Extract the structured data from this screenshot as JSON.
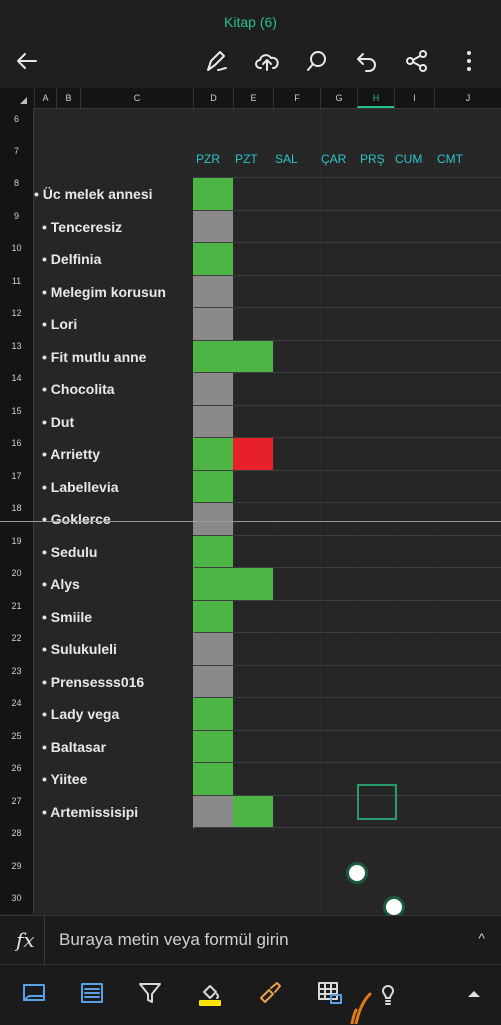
{
  "app": {
    "title": "Kitap (6)"
  },
  "toolbar": {
    "icons": [
      "back-arrow-icon",
      "draw-pen-icon",
      "cloud-upload-icon",
      "search-icon",
      "undo-icon",
      "share-icon",
      "more-icon"
    ]
  },
  "sheet": {
    "columns": [
      "A",
      "B",
      "C",
      "D",
      "E",
      "F",
      "G",
      "H",
      "I",
      "J"
    ],
    "selected_column": "H",
    "rows": [
      "6",
      "7",
      "8",
      "9",
      "10",
      "11",
      "12",
      "13",
      "14",
      "15",
      "16",
      "17",
      "18",
      "19",
      "20",
      "21",
      "22",
      "23",
      "24",
      "25",
      "26",
      "27",
      "28",
      "29",
      "30"
    ],
    "days": [
      "PZR",
      "PZT",
      "SAL",
      "ÇAR",
      "PRŞ",
      "CUM",
      "CMT"
    ],
    "entries": [
      {
        "name": "• Üc melek annesi",
        "cells": [
          "green"
        ]
      },
      {
        "name": "•  Tenceresiz",
        "cells": [
          "gray"
        ]
      },
      {
        "name": "•  Delfinia",
        "cells": [
          "green"
        ]
      },
      {
        "name": "•  Melegim korusun",
        "cells": [
          "gray"
        ]
      },
      {
        "name": "•  Lori",
        "cells": [
          "gray"
        ]
      },
      {
        "name": "•  Fit mutlu anne",
        "cells": [
          "green",
          "green"
        ]
      },
      {
        "name": "•  Chocolita",
        "cells": [
          "gray"
        ]
      },
      {
        "name": "•  Dut",
        "cells": [
          "gray"
        ]
      },
      {
        "name": "•  Arrietty",
        "cells": [
          "green",
          "red"
        ]
      },
      {
        "name": "•  Labellevia",
        "cells": [
          "green"
        ]
      },
      {
        "name": "•  Goklerce",
        "cells": [
          "gray"
        ]
      },
      {
        "name": "•  Sedulu",
        "cells": [
          "green"
        ]
      },
      {
        "name": "•  Alys",
        "cells": [
          "green",
          "green"
        ]
      },
      {
        "name": "•  Smiile",
        "cells": [
          "green"
        ]
      },
      {
        "name": "•  Sulukuleli",
        "cells": [
          "gray"
        ]
      },
      {
        "name": "•  Prensesss016",
        "cells": [
          "gray"
        ]
      },
      {
        "name": "•  Lady vega",
        "cells": [
          "green"
        ]
      },
      {
        "name": "•  Baltasar",
        "cells": [
          "green"
        ]
      },
      {
        "name": "•  Yiitee",
        "cells": [
          "green"
        ]
      },
      {
        "name": "•  Artemissisipi",
        "cells": [
          "gray",
          "green"
        ]
      }
    ]
  },
  "formula_bar": {
    "label": "fx",
    "placeholder": "Buraya metin veya formül girin"
  },
  "bottom_bar": {
    "icons": [
      "sheet-view-icon",
      "table-format-icon",
      "filter-icon",
      "fill-color-icon",
      "format-painter-icon",
      "insert-picture-table-icon",
      "tell-me-bulb-icon",
      "expand-up-icon"
    ]
  },
  "colors": {
    "accent": "#27c08a",
    "day_label": "#2ec5c9",
    "green": "#4cb543",
    "gray": "#8a8a8a",
    "red": "#e8202a"
  }
}
